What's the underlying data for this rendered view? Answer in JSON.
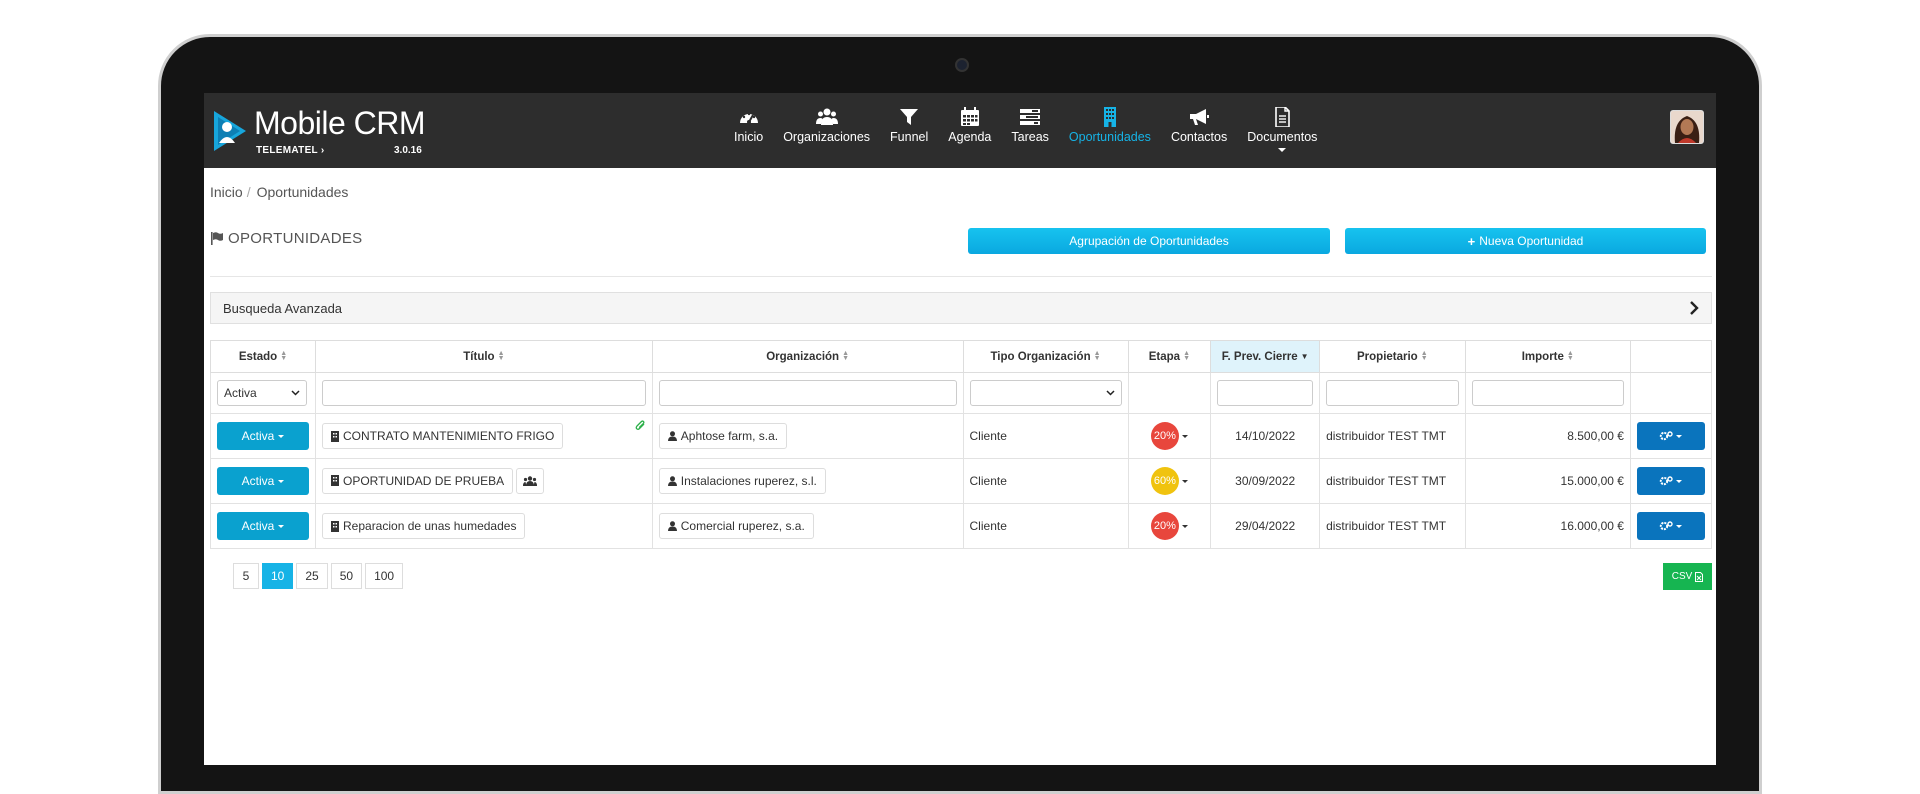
{
  "brand": {
    "title": "Mobile CRM",
    "subtitle": "TELEMATEL",
    "subtitle_arrow": "›",
    "version": "3.0.16",
    "accent": "#16b3e6"
  },
  "nav": [
    {
      "label": "Inicio",
      "icon": "dashboard-icon"
    },
    {
      "label": "Organizaciones",
      "icon": "users-icon"
    },
    {
      "label": "Funnel",
      "icon": "funnel-icon"
    },
    {
      "label": "Agenda",
      "icon": "calendar-icon"
    },
    {
      "label": "Tareas",
      "icon": "tasks-icon"
    },
    {
      "label": "Oportunidades",
      "icon": "building-icon",
      "active": true
    },
    {
      "label": "Contactos",
      "icon": "megaphone-icon"
    },
    {
      "label": "Documentos",
      "icon": "document-icon",
      "dropdown": true
    }
  ],
  "breadcrumb": {
    "home": "Inicio",
    "sep": "/",
    "current": "Oportunidades"
  },
  "page": {
    "title": "OPORTUNIDADES",
    "btn_group": "Agrupación de Oportunidades",
    "btn_new": "Nueva Oportunidad",
    "advanced_search": "Busqueda Avanzada"
  },
  "table": {
    "headers": [
      "Estado",
      "Título",
      "Organización",
      "Tipo Organización",
      "Etapa",
      "F. Prev. Cierre",
      "Propietario",
      "Importe"
    ],
    "filter_estado": "Activa",
    "rows": [
      {
        "estado": "Activa",
        "titulo": "CONTRATO MANTENIMIENTO FRIGO",
        "organizacion": "Aphtose farm, s.a.",
        "tipo": "Cliente",
        "etapa": "20%",
        "etapa_color": "#e8463c",
        "fecha": "14/10/2022",
        "propietario": "distribuidor TEST TMT",
        "importe": "8.500,00 €"
      },
      {
        "estado": "Activa",
        "titulo": "OPORTUNIDAD DE PRUEBA",
        "organizacion": "Instalaciones ruperez, s.l.",
        "tipo": "Cliente",
        "etapa": "60%",
        "etapa_color": "#f0c30f",
        "fecha": "30/09/2022",
        "propietario": "distribuidor TEST TMT",
        "importe": "15.000,00 €"
      },
      {
        "estado": "Activa",
        "titulo": "Reparacion de unas humedades",
        "organizacion": "Comercial ruperez, s.a.",
        "tipo": "Cliente",
        "etapa": "20%",
        "etapa_color": "#e8463c",
        "fecha": "29/04/2022",
        "propietario": "distribuidor TEST TMT",
        "importe": "16.000,00 €"
      }
    ]
  },
  "pagination": {
    "sizes": [
      "5",
      "10",
      "25",
      "50",
      "100"
    ],
    "active": "10"
  },
  "csv_label": "CSV"
}
